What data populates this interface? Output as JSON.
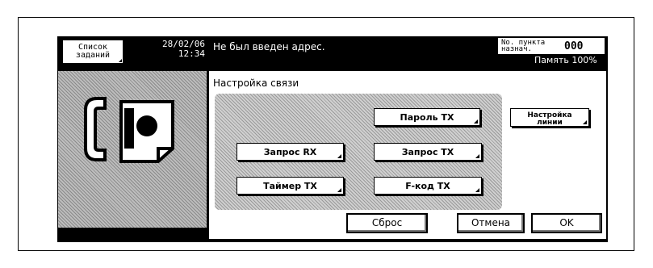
{
  "header": {
    "job_list_label": "Список заданий",
    "date": "28/02/06",
    "time": "12:34",
    "message": "Не был введен адрес.",
    "dest_label_line1": "No. пункта",
    "dest_label_line2": "назнач.",
    "dest_count": "000",
    "memory": "Память 100%"
  },
  "panel": {
    "title": "Настройка связи"
  },
  "buttons": {
    "password_tx": "Пароль TX",
    "line_settings_line1": "Настройка",
    "line_settings_line2": "линии",
    "polling_rx": "Запрос RX",
    "polling_tx": "Запрос TX",
    "timer_tx": "Таймер TX",
    "f_code_tx": "F-код TX",
    "reset": "Сброс",
    "cancel": "Отмена",
    "ok": "OK"
  },
  "icons": {
    "left_pane": "fax-icon"
  }
}
